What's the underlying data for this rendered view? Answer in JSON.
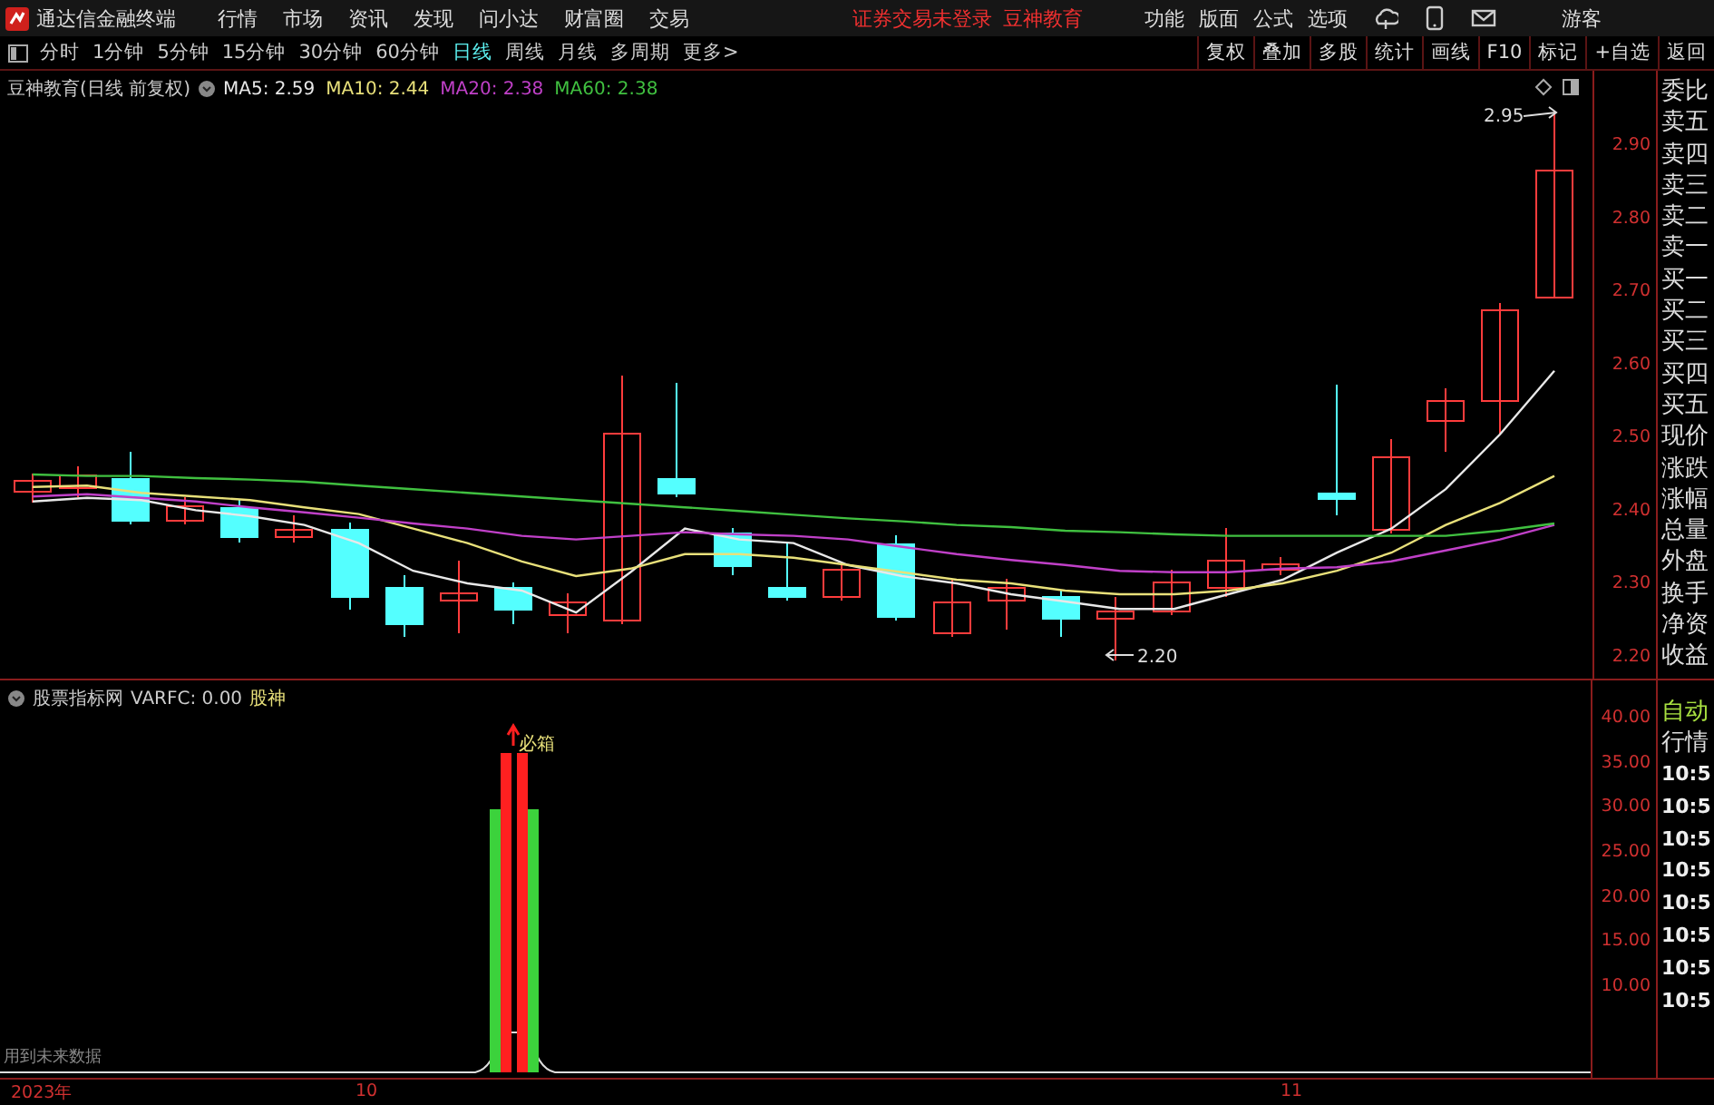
{
  "title_bar": {
    "app_name": "通达信金融终端",
    "menu": [
      "行情",
      "市场",
      "资讯",
      "发现",
      "问小达",
      "财富圈",
      "交易"
    ],
    "notices": [
      "证券交易未登录",
      "豆神教育"
    ],
    "tools": [
      "功能",
      "版面",
      "公式",
      "选项"
    ],
    "user": "游客"
  },
  "toolbar": {
    "periods": [
      {
        "label": "分时",
        "selected": false
      },
      {
        "label": "1分钟",
        "selected": false
      },
      {
        "label": "5分钟",
        "selected": false
      },
      {
        "label": "15分钟",
        "selected": false
      },
      {
        "label": "30分钟",
        "selected": false
      },
      {
        "label": "60分钟",
        "selected": false
      },
      {
        "label": "日线",
        "selected": true
      },
      {
        "label": "周线",
        "selected": false
      },
      {
        "label": "月线",
        "selected": false
      },
      {
        "label": "多周期",
        "selected": false
      },
      {
        "label": "更多>",
        "selected": false
      }
    ],
    "actions": [
      "复权",
      "叠加",
      "多股",
      "统计",
      "画线",
      "F10",
      "标记",
      "+自选",
      "返回"
    ]
  },
  "price_chart": {
    "title": "豆神教育(日线 前复权)",
    "annotations": [
      "2.95",
      "2.20"
    ],
    "chart_data": {
      "type": "line",
      "ylim": [
        2.165,
        3.0
      ],
      "yticks": [
        {
          "value": 2.9,
          "label": "2.90"
        },
        {
          "value": 2.8,
          "label": "2.80"
        },
        {
          "value": 2.7,
          "label": "2.70"
        },
        {
          "value": 2.6,
          "label": "2.60"
        },
        {
          "value": 2.5,
          "label": "2.50"
        },
        {
          "value": 2.4,
          "label": "2.40"
        },
        {
          "value": 2.3,
          "label": "2.30"
        },
        {
          "value": 2.2,
          "label": "2.20"
        }
      ],
      "series": [
        {
          "name": "MA5: 2.59",
          "color": "#e8e8e8",
          "values": [
            2.41,
            2.415,
            2.412,
            2.398,
            2.39,
            2.378,
            2.353,
            2.315,
            2.298,
            2.288,
            2.258,
            2.313,
            2.373,
            2.358,
            2.353,
            2.323,
            2.308,
            2.298,
            2.283,
            2.273,
            2.263,
            2.263,
            2.283,
            2.303,
            2.34,
            2.373,
            2.427,
            2.502,
            2.589
          ]
        },
        {
          "name": "MA10: 2.44",
          "color": "#e8e07a",
          "values": [
            2.43,
            2.432,
            2.422,
            2.417,
            2.412,
            2.402,
            2.393,
            2.373,
            2.353,
            2.328,
            2.308,
            2.318,
            2.338,
            2.338,
            2.333,
            2.323,
            2.313,
            2.303,
            2.298,
            2.288,
            2.283,
            2.283,
            2.288,
            2.298,
            2.315,
            2.34,
            2.378,
            2.408,
            2.445
          ]
        },
        {
          "name": "MA20: 2.38",
          "color": "#c040c8",
          "values": [
            2.417,
            2.42,
            2.415,
            2.41,
            2.402,
            2.395,
            2.388,
            2.38,
            2.373,
            2.363,
            2.358,
            2.363,
            2.368,
            2.365,
            2.363,
            2.358,
            2.348,
            2.338,
            2.33,
            2.323,
            2.315,
            2.313,
            2.313,
            2.318,
            2.32,
            2.328,
            2.343,
            2.358,
            2.378
          ]
        },
        {
          "name": "MA60: 2.38",
          "color": "#40c040",
          "values": [
            2.447,
            2.445,
            2.445,
            2.442,
            2.44,
            2.437,
            2.432,
            2.427,
            2.422,
            2.417,
            2.412,
            2.407,
            2.402,
            2.397,
            2.392,
            2.387,
            2.383,
            2.378,
            2.375,
            2.37,
            2.368,
            2.365,
            2.363,
            2.363,
            2.363,
            2.363,
            2.363,
            2.37,
            2.38
          ]
        }
      ]
    }
  },
  "indicator_chart": {
    "title": "股票指标网",
    "reading": "VARFC: 0.00",
    "tag": "股神",
    "signal": "必箱",
    "note": "用到未来数据",
    "yticks": [
      "40.00",
      "35.00",
      "30.00",
      "25.00",
      "20.00",
      "15.00",
      "10.00"
    ]
  },
  "time_axis": [
    "2023年",
    "10",
    "11"
  ],
  "quote_panel": {
    "labels": [
      "委比",
      "卖五",
      "卖四",
      "卖三",
      "卖二",
      "卖一",
      "买一",
      "买二",
      "买三",
      "买四",
      "买五",
      "现价",
      "涨跌",
      "涨幅",
      "总量",
      "外盘",
      "换手",
      "净资",
      "收益"
    ]
  },
  "tick_panel": {
    "modes": [
      {
        "label": "自动",
        "selected": true
      },
      {
        "label": "行情",
        "selected": false
      }
    ],
    "times": [
      "10:5",
      "10:5",
      "10:5",
      "10:5",
      "10:5",
      "10:5",
      "10:5",
      "10:5"
    ]
  }
}
